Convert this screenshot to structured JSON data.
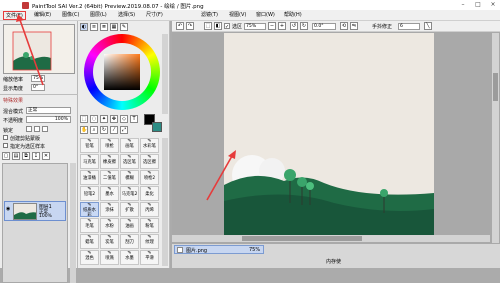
{
  "titlebar": {
    "title": "PaintTool SAI Ver.2 (64bit) Preview.2019.08.07 - 绘绘 / 图片.png"
  },
  "menus": [
    "文件(F)",
    "编辑(E)",
    "图像(C)",
    "图层(L)",
    "选择(S)",
    "尺寸(F)",
    "滤镜(T)",
    "视图(V)",
    "窗口(W)",
    "帮助(H)"
  ],
  "toolbar": {
    "selection_label": "选区",
    "zoom": "75%",
    "rotation": "0.0°",
    "stabilizer_label": "手抖修正",
    "stabilizer_value": "6"
  },
  "navigator": {
    "zoom_label": "缩放倍率",
    "zoom_value": "75%",
    "rotate_label": "显示角度",
    "rotate_value": "0°"
  },
  "layer_props": {
    "section": "特殊效果",
    "blend_label": "混合模式",
    "blend_value": "正常",
    "opacity_label": "不透明度",
    "opacity_value": "100%",
    "lock_label": "锁定",
    "clip_label": "创建剪贴蒙版",
    "ref_label": "指定为选区样本"
  },
  "layers": [
    {
      "name": "图层1",
      "mode": "正常",
      "opacity": "100%"
    }
  ],
  "tools": [
    [
      "铅笔",
      "喷枪",
      "画笔",
      "水彩笔"
    ],
    [
      "马克笔",
      "橡皮擦",
      "选区笔",
      "选区擦"
    ],
    [
      "油漆桶",
      "二值笔",
      "模糊",
      "喷枪2"
    ],
    [
      "铅笔2",
      "墨水",
      "马克笔2",
      "柔化"
    ],
    [
      "纸质水彩",
      "涂抹",
      "扩散",
      "丙烯"
    ],
    [
      "毛笔",
      "水粉",
      "油画",
      "粉笔"
    ],
    [
      "蜡笔",
      "炭笔",
      "刮刀",
      "纹理"
    ],
    [
      "混色",
      "喷溅",
      "水墨",
      "平滑"
    ]
  ],
  "tools_selected": "纸质水彩",
  "documents": [
    {
      "name": "图片.png",
      "zoom": "75%"
    }
  ],
  "status": {
    "memory": "内存使"
  },
  "colors": {
    "accent": "#e63b3b",
    "hill": "#1f6b45",
    "tree": "#3aa56b",
    "sky": "#ede8e1",
    "fg_color": "#000000",
    "bg_color": "#2c8c84"
  }
}
